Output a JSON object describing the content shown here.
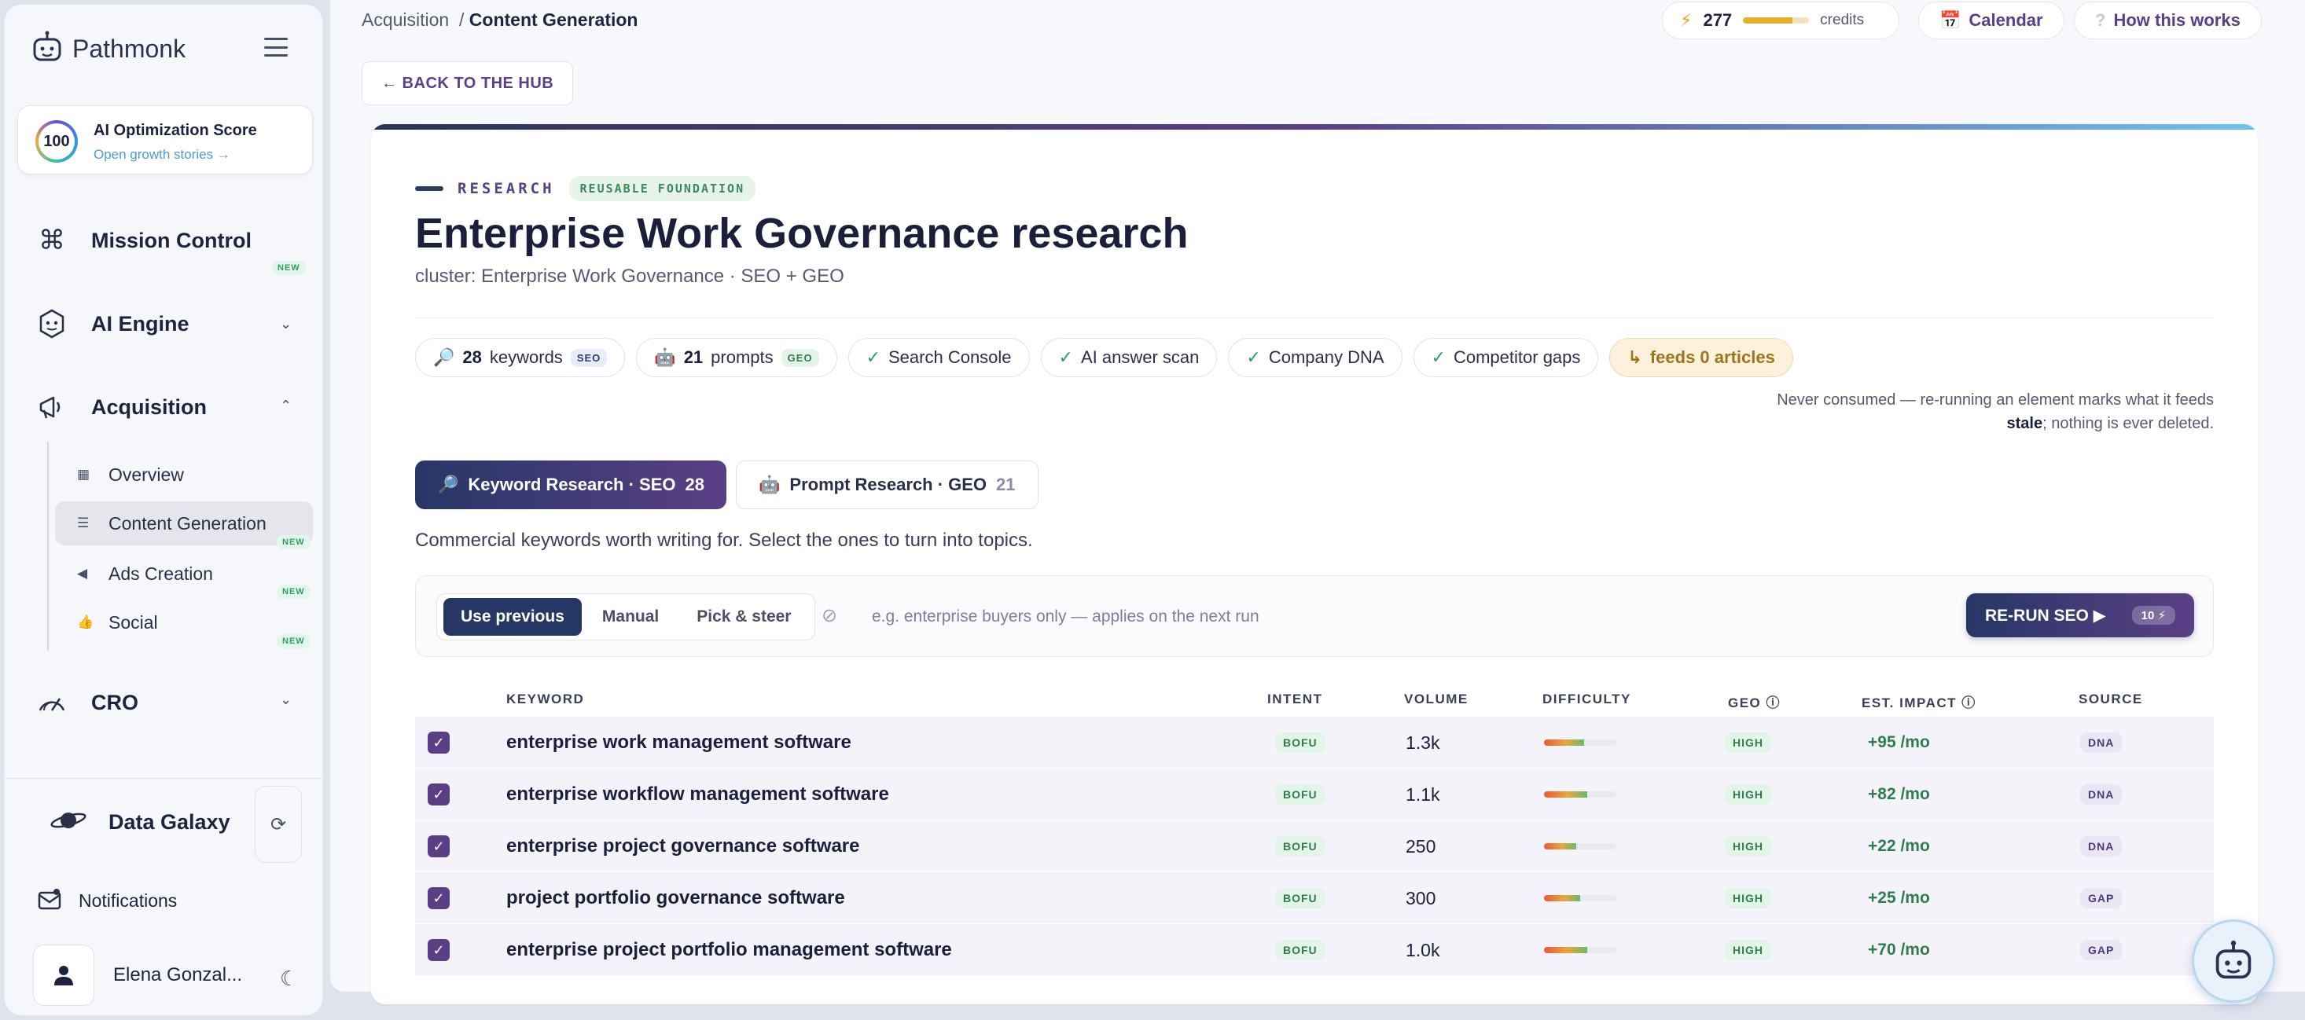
{
  "sidebar": {
    "brand": "Pathmonk",
    "score": {
      "value": "100",
      "title": "AI Optimization Score",
      "link": "Open growth stories →"
    },
    "nav": [
      {
        "label": "Mission Control",
        "badge": "NEW"
      },
      {
        "label": "AI Engine"
      },
      {
        "label": "Acquisition"
      },
      {
        "label": "CRO"
      }
    ],
    "sub_items": [
      {
        "label": "Overview"
      },
      {
        "label": "Content Generation",
        "badge": "NEW"
      },
      {
        "label": "Ads Creation",
        "badge": "NEW"
      },
      {
        "label": "Social",
        "badge": "NEW"
      }
    ],
    "data_galaxy": "Data Galaxy",
    "notifications": "Notifications",
    "user_name": "Elena Gonzal..."
  },
  "header": {
    "breadcrumb_parent": "Acquisition",
    "breadcrumb_sep": "/",
    "breadcrumb_current": "Content Generation",
    "credits_value": "277",
    "credits_unit": "credits",
    "credits_fill": 0.75,
    "calendar_label": "Calendar",
    "how_label": "How this works",
    "back_label": "← BACK TO THE HUB"
  },
  "card": {
    "eyebrow": "RESEARCH",
    "tag": "REUSABLE FOUNDATION",
    "title": "Enterprise Work Governance research",
    "subtitle": "cluster: Enterprise Work Governance · SEO + GEO",
    "chips": {
      "keywords_count": "28",
      "keywords_label": "keywords",
      "keywords_tag": "SEO",
      "prompts_count": "21",
      "prompts_label": "prompts",
      "prompts_tag": "GEO",
      "search_console": "Search Console",
      "ai_scan": "AI answer scan",
      "company_dna": "Company DNA",
      "competitor_gaps": "Competitor gaps",
      "feeds": "feeds 0 articles"
    },
    "note_line1": "Never consumed — re-running an element marks what it feeds",
    "note_stale": "stale",
    "note_line2": "; nothing is ever deleted.",
    "tabs": [
      {
        "label": "Keyword Research · SEO",
        "count": "28"
      },
      {
        "label": "Prompt Research · GEO",
        "count": "21"
      }
    ],
    "helper": "Commercial keywords worth writing for. Select the ones to turn into topics.",
    "modes": [
      "Use previous",
      "Manual",
      "Pick & steer"
    ],
    "steer_placeholder": "e.g. enterprise buyers only — applies on the next run",
    "rerun_label": "RE-RUN SEO ▶",
    "rerun_cost": "10 ⚡"
  },
  "table": {
    "headers": {
      "keyword": "KEYWORD",
      "intent": "INTENT",
      "volume": "VOLUME",
      "difficulty": "DIFFICULTY",
      "geo": "GEO ⓘ",
      "impact": "EST. IMPACT ⓘ",
      "source": "SOURCE"
    },
    "rows": [
      {
        "keyword": "enterprise work management software",
        "intent": "BOFU",
        "volume": "1.3k",
        "difficulty": 0.55,
        "geo": "HIGH",
        "impact": "+95 /mo",
        "source": "DNA"
      },
      {
        "keyword": "enterprise workflow management software",
        "intent": "BOFU",
        "volume": "1.1k",
        "difficulty": 0.6,
        "geo": "HIGH",
        "impact": "+82 /mo",
        "source": "DNA"
      },
      {
        "keyword": "enterprise project governance software",
        "intent": "BOFU",
        "volume": "250",
        "difficulty": 0.45,
        "geo": "HIGH",
        "impact": "+22 /mo",
        "source": "DNA"
      },
      {
        "keyword": "project portfolio governance software",
        "intent": "BOFU",
        "volume": "300",
        "difficulty": 0.5,
        "geo": "HIGH",
        "impact": "+25 /mo",
        "source": "GAP"
      },
      {
        "keyword": "enterprise project portfolio management software",
        "intent": "BOFU",
        "volume": "1.0k",
        "difficulty": 0.6,
        "geo": "HIGH",
        "impact": "+70 /mo",
        "source": "GAP"
      }
    ]
  }
}
